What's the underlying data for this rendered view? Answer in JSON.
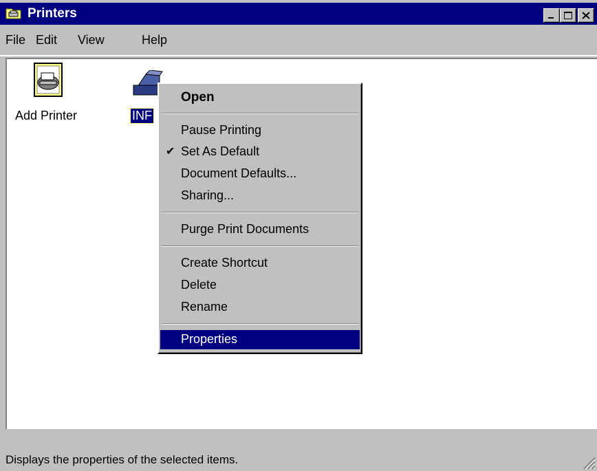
{
  "window": {
    "title": "Printers",
    "title_icon": "printers-folder-icon",
    "controls": [
      "minimize-icon",
      "maximize-icon",
      "close-icon"
    ]
  },
  "menubar": {
    "items": [
      {
        "label": "File"
      },
      {
        "label": "Edit"
      },
      {
        "label": "View"
      },
      {
        "label": "Help"
      }
    ]
  },
  "icons": [
    {
      "label": "Add Printer",
      "icon": "add-printer-icon"
    },
    {
      "label": "INF",
      "icon": "printer-icon",
      "selected": true
    }
  ],
  "context_menu": {
    "items": [
      {
        "label": "Open",
        "bold": true
      },
      {
        "label": "Pause Printing"
      },
      {
        "label": "Set As Default",
        "checked": true
      },
      {
        "label": "Document Defaults..."
      },
      {
        "label": "Sharing..."
      },
      {
        "label": "Purge Print Documents"
      },
      {
        "label": "Create Shortcut"
      },
      {
        "label": "Delete"
      },
      {
        "label": "Rename"
      },
      {
        "label": "Properties",
        "selected": true
      }
    ],
    "check_mark": "✔"
  },
  "status": {
    "text": "Displays the properties of the selected items."
  },
  "colors": {
    "title_bar": "#000080",
    "face": "#c0c0c0",
    "selection": "#000080",
    "content": "#ffffff"
  }
}
